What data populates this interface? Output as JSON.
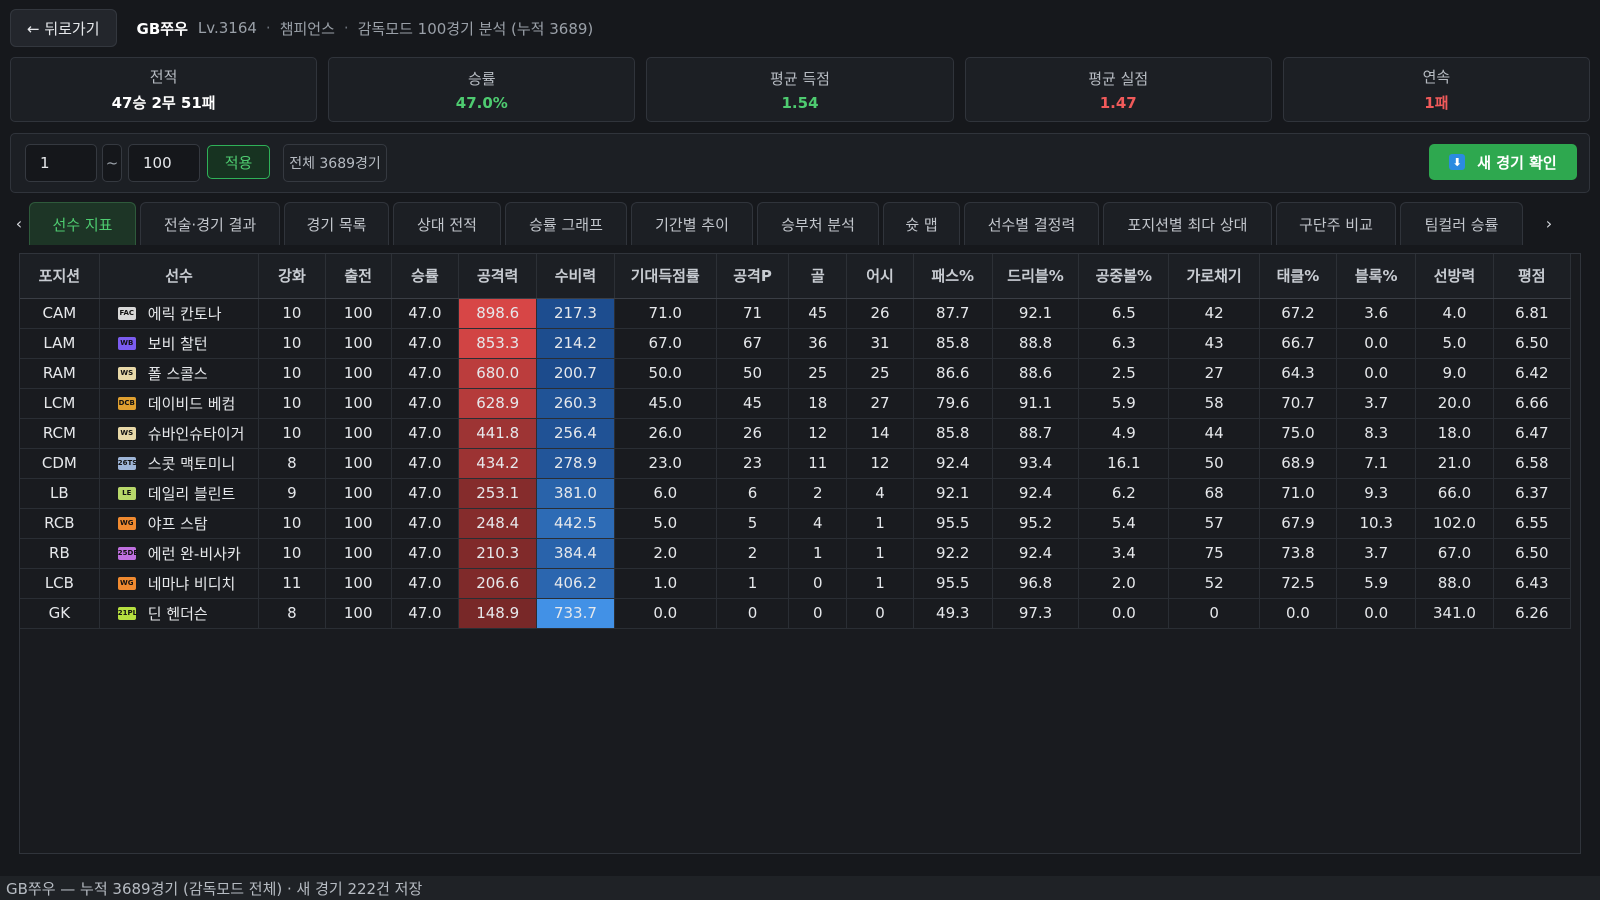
{
  "header": {
    "back_label": "← 뒤로가기",
    "nickname": "GB쭈우",
    "level": "Lv.3164",
    "division": "챔피언스",
    "analysis_label": "감독모드 100경기 분석 (누적 3689)"
  },
  "stats": [
    {
      "label": "전적",
      "value": "47승 2무 51패",
      "color": "#ffffff"
    },
    {
      "label": "승률",
      "value": "47.0%",
      "color": "#4ecb70"
    },
    {
      "label": "평균 득점",
      "value": "1.54",
      "color": "#4ecb70"
    },
    {
      "label": "평균 실점",
      "value": "1.47",
      "color": "#f05a5a"
    },
    {
      "label": "연속",
      "value": "1패",
      "color": "#f05a5a"
    }
  ],
  "filter": {
    "from_value": "1",
    "tilde": "~",
    "to_value": "100",
    "apply_label": "적용",
    "total_label": "전체 3689경기",
    "new_match_label": "새 경기 확인"
  },
  "tabs": [
    {
      "label": "선수 지표",
      "active": true
    },
    {
      "label": "전술·경기 결과",
      "active": false
    },
    {
      "label": "경기 목록",
      "active": false
    },
    {
      "label": "상대 전적",
      "active": false
    },
    {
      "label": "승률 그래프",
      "active": false
    },
    {
      "label": "기간별 추이",
      "active": false
    },
    {
      "label": "승부처 분석",
      "active": false
    },
    {
      "label": "슛 맵",
      "active": false
    },
    {
      "label": "선수별 결정력",
      "active": false
    },
    {
      "label": "포지션별 최다 상대",
      "active": false
    },
    {
      "label": "구단주 비교",
      "active": false
    },
    {
      "label": "팀컬러 승률",
      "active": false
    }
  ],
  "table": {
    "columns": [
      "포지션",
      "선수",
      "강화",
      "출전",
      "승률",
      "공격력",
      "수비력",
      "기대득점률",
      "공격P",
      "골",
      "어시",
      "패스%",
      "드리블%",
      "공중볼%",
      "가로채기",
      "태클%",
      "블록%",
      "선방력",
      "평점"
    ],
    "rows": [
      {
        "pos": "CAM",
        "badge": "FAC",
        "badge_color": "#d8d8d8",
        "name": "에릭 칸토나",
        "enh": "10",
        "apps": "100",
        "win": "47.0",
        "atk": "898.6",
        "def": "217.3",
        "xg": "71.0",
        "atkp": "71",
        "goals": "45",
        "assists": "26",
        "pass": "87.7",
        "dribble": "92.1",
        "aerial": "6.5",
        "intercept": "42",
        "tackle": "67.2",
        "block": "3.6",
        "save": "4.0",
        "rating": "6.81"
      },
      {
        "pos": "LAM",
        "badge": "WB",
        "badge_color": "#7b5cf0",
        "name": "보비 찰턴",
        "enh": "10",
        "apps": "100",
        "win": "47.0",
        "atk": "853.3",
        "def": "214.2",
        "xg": "67.0",
        "atkp": "67",
        "goals": "36",
        "assists": "31",
        "pass": "85.8",
        "dribble": "88.8",
        "aerial": "6.3",
        "intercept": "43",
        "tackle": "66.7",
        "block": "0.0",
        "save": "5.0",
        "rating": "6.50"
      },
      {
        "pos": "RAM",
        "badge": "WS",
        "badge_color": "#e8d9a8",
        "name": "폴 스콜스",
        "enh": "10",
        "apps": "100",
        "win": "47.0",
        "atk": "680.0",
        "def": "200.7",
        "xg": "50.0",
        "atkp": "50",
        "goals": "25",
        "assists": "25",
        "pass": "86.6",
        "dribble": "88.6",
        "aerial": "2.5",
        "intercept": "27",
        "tackle": "64.3",
        "block": "0.0",
        "save": "9.0",
        "rating": "6.42"
      },
      {
        "pos": "LCM",
        "badge": "DCB",
        "badge_color": "#e0a030",
        "name": "데이비드 베컴",
        "enh": "10",
        "apps": "100",
        "win": "47.0",
        "atk": "628.9",
        "def": "260.3",
        "xg": "45.0",
        "atkp": "45",
        "goals": "18",
        "assists": "27",
        "pass": "79.6",
        "dribble": "91.1",
        "aerial": "5.9",
        "intercept": "58",
        "tackle": "70.7",
        "block": "3.7",
        "save": "20.0",
        "rating": "6.66"
      },
      {
        "pos": "RCM",
        "badge": "WS",
        "badge_color": "#e8d9a8",
        "name": "슈바인슈타이거",
        "enh": "10",
        "apps": "100",
        "win": "47.0",
        "atk": "441.8",
        "def": "256.4",
        "xg": "26.0",
        "atkp": "26",
        "goals": "12",
        "assists": "14",
        "pass": "85.8",
        "dribble": "88.7",
        "aerial": "4.9",
        "intercept": "44",
        "tackle": "75.0",
        "block": "8.3",
        "save": "18.0",
        "rating": "6.47"
      },
      {
        "pos": "CDM",
        "badge": "26TS",
        "badge_color": "#9fb6d8",
        "name": "스콧 맥토미니",
        "enh": "8",
        "apps": "100",
        "win": "47.0",
        "atk": "434.2",
        "def": "278.9",
        "xg": "23.0",
        "atkp": "23",
        "goals": "11",
        "assists": "12",
        "pass": "92.4",
        "dribble": "93.4",
        "aerial": "16.1",
        "intercept": "50",
        "tackle": "68.9",
        "block": "7.1",
        "save": "21.0",
        "rating": "6.58"
      },
      {
        "pos": "LB",
        "badge": "LE",
        "badge_color": "#b8d86a",
        "name": "데일리 블린트",
        "enh": "9",
        "apps": "100",
        "win": "47.0",
        "atk": "253.1",
        "def": "381.0",
        "xg": "6.0",
        "atkp": "6",
        "goals": "2",
        "assists": "4",
        "pass": "92.1",
        "dribble": "92.4",
        "aerial": "6.2",
        "intercept": "68",
        "tackle": "71.0",
        "block": "9.3",
        "save": "66.0",
        "rating": "6.37"
      },
      {
        "pos": "RCB",
        "badge": "WG",
        "badge_color": "#f08a30",
        "name": "야프 스탐",
        "enh": "10",
        "apps": "100",
        "win": "47.0",
        "atk": "248.4",
        "def": "442.5",
        "xg": "5.0",
        "atkp": "5",
        "goals": "4",
        "assists": "1",
        "pass": "95.5",
        "dribble": "95.2",
        "aerial": "5.4",
        "intercept": "57",
        "tackle": "67.9",
        "block": "10.3",
        "save": "102.0",
        "rating": "6.55"
      },
      {
        "pos": "RB",
        "badge": "25DE",
        "badge_color": "#c070e0",
        "name": "에런 완-비사카",
        "enh": "10",
        "apps": "100",
        "win": "47.0",
        "atk": "210.3",
        "def": "384.4",
        "xg": "2.0",
        "atkp": "2",
        "goals": "1",
        "assists": "1",
        "pass": "92.2",
        "dribble": "92.4",
        "aerial": "3.4",
        "intercept": "75",
        "tackle": "73.8",
        "block": "3.7",
        "save": "67.0",
        "rating": "6.50"
      },
      {
        "pos": "LCB",
        "badge": "WG",
        "badge_color": "#f08a30",
        "name": "네마냐 비디치",
        "enh": "11",
        "apps": "100",
        "win": "47.0",
        "atk": "206.6",
        "def": "406.2",
        "xg": "1.0",
        "atkp": "1",
        "goals": "0",
        "assists": "1",
        "pass": "95.5",
        "dribble": "96.8",
        "aerial": "2.0",
        "intercept": "52",
        "tackle": "72.5",
        "block": "5.9",
        "save": "88.0",
        "rating": "6.43"
      },
      {
        "pos": "GK",
        "badge": "21PL",
        "badge_color": "#b6e040",
        "name": "딘 헨더슨",
        "enh": "8",
        "apps": "100",
        "win": "47.0",
        "atk": "148.9",
        "def": "733.7",
        "xg": "0.0",
        "atkp": "0",
        "goals": "0",
        "assists": "0",
        "pass": "49.3",
        "dribble": "97.3",
        "aerial": "0.0",
        "intercept": "0",
        "tackle": "0.0",
        "block": "0.0",
        "save": "341.0",
        "rating": "6.26"
      }
    ]
  },
  "statusbar": {
    "text": "GB쭈우 — 누적 3689경기 (감독모드 전체) · 새 경기 222건 저장"
  },
  "icons": {
    "back": "left-arrow-icon",
    "new_match": "download-icon",
    "tab_prev": "chevron-left-icon",
    "tab_next": "chevron-right-icon"
  },
  "colors": {
    "attack_heat": "#d64545",
    "defense_heat": "#2f74c8",
    "accent_green": "#4ecb70",
    "loss_red": "#f05a5a"
  }
}
